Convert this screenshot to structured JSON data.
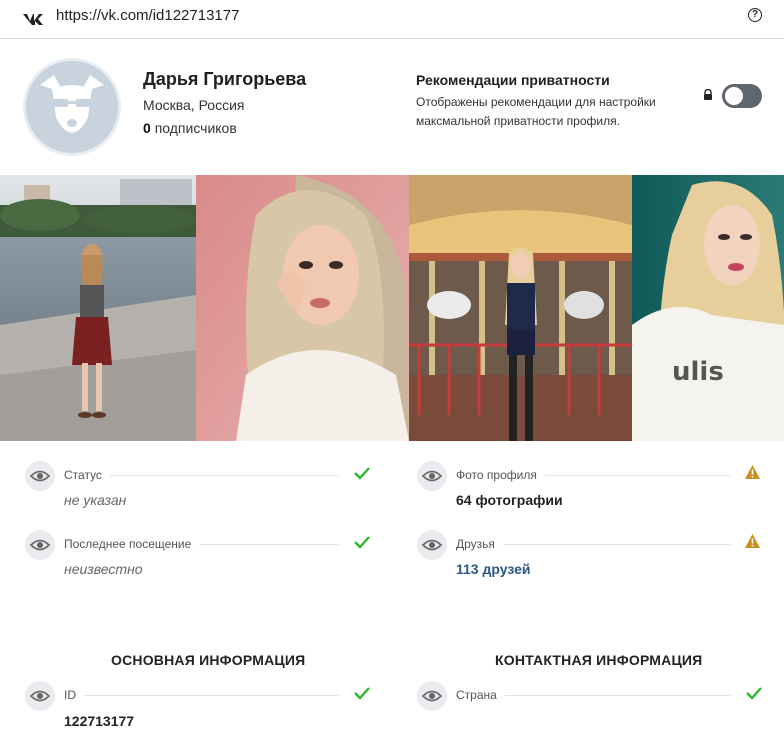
{
  "browser": {
    "url": "https://vk.com/id122713177",
    "logo_icon": "vk-logo-icon",
    "help_icon": "help-circle-icon"
  },
  "profile": {
    "name": "Дарья Григорьева",
    "location": "Москва, Россия",
    "subscribers_count": "0",
    "subscribers_label": "подписчиков"
  },
  "privacy": {
    "title": "Рекомендации приватности",
    "description": "Отображены рекомендации для настройки максмальной приватности профиля.",
    "toggle_on": false,
    "lock_icon": "lock-icon"
  },
  "photos": [
    "photo-1",
    "photo-2",
    "photo-3",
    "photo-4"
  ],
  "info": {
    "status": {
      "label": "Статус",
      "value": "не указан",
      "state": "ok"
    },
    "last_visit": {
      "label": "Последнее посещение",
      "value": "неизвестно",
      "state": "ok"
    },
    "profile_photos": {
      "label": "Фото профиля",
      "value": "64 фотографии",
      "state": "warning"
    },
    "friends": {
      "label": "Друзья",
      "value": "113 друзей",
      "state": "warning"
    }
  },
  "sections": {
    "basic": {
      "title": "ОСНОВНАЯ ИНФОРМАЦИЯ",
      "id_label": "ID",
      "id_value": "122713177",
      "id_state": "ok"
    },
    "contact": {
      "title": "КОНТАКТНАЯ ИНФОРМАЦИЯ",
      "country_label": "Страна",
      "country_state": "ok"
    }
  },
  "colors": {
    "ok_green": "#2db82d",
    "warn_amber": "#c7901f",
    "link_blue": "#2a5885",
    "toggle_off": "#5f6670"
  }
}
